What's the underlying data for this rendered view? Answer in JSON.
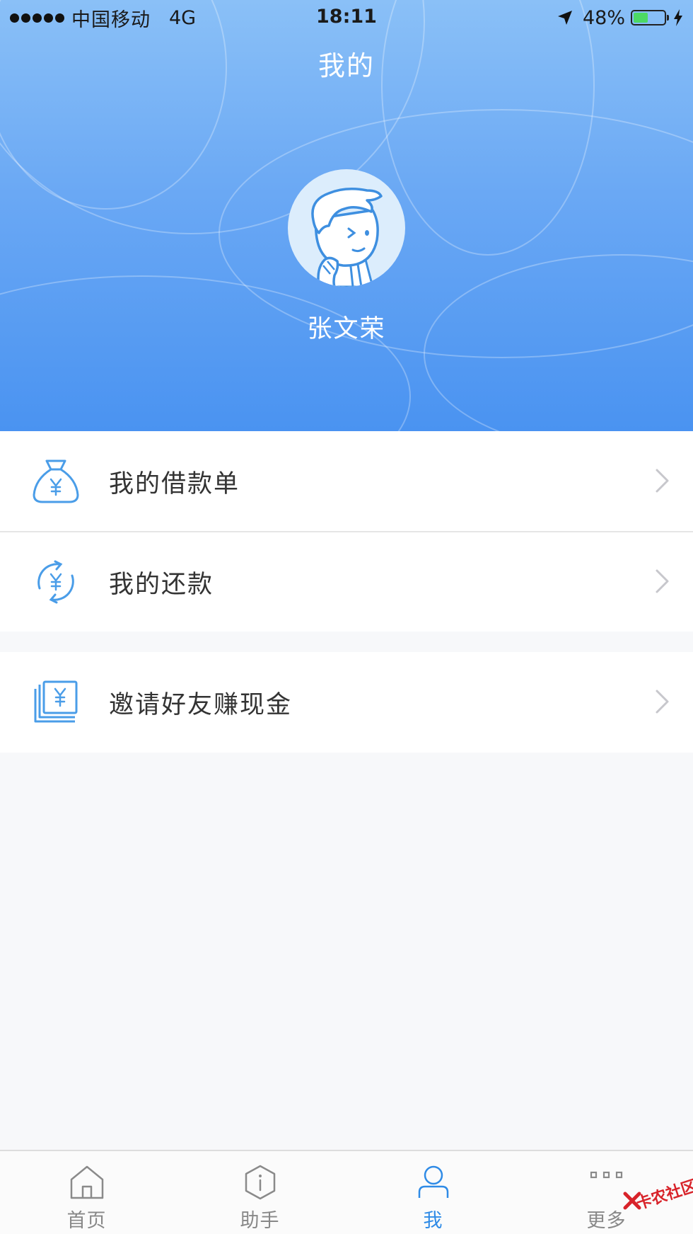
{
  "status_bar": {
    "carrier": "中国移动",
    "network": "4G",
    "time": "18:11",
    "battery_percent": "48%",
    "battery_level": 0.48,
    "icons": [
      "signal-icon",
      "location-arrow-icon",
      "battery-icon",
      "charging-bolt-icon"
    ]
  },
  "header": {
    "title": "我的"
  },
  "profile": {
    "name": "张文荣",
    "avatar_icon": "cartoon-avatar-icon"
  },
  "menu": {
    "items": [
      {
        "label": "我的借款单",
        "icon": "money-bag-icon"
      },
      {
        "label": "我的还款",
        "icon": "repay-cycle-icon"
      },
      {
        "label": "邀请好友赚现金",
        "icon": "cash-card-icon"
      }
    ]
  },
  "tabbar": {
    "tabs": [
      {
        "label": "首页",
        "icon": "home-icon",
        "active": false
      },
      {
        "label": "助手",
        "icon": "info-icon",
        "active": false
      },
      {
        "label": "我",
        "icon": "user-icon",
        "active": true
      },
      {
        "label": "更多",
        "icon": "more-icon",
        "active": false
      }
    ]
  },
  "watermark": {
    "text": "卡农社区"
  },
  "colors": {
    "header_top": "#8ac0f7",
    "header_bottom": "#4a93f1",
    "icon_blue": "#4a9de8",
    "active_tab": "#2f8be6",
    "inactive_tab": "#888888",
    "background": "#f7f8fa"
  }
}
